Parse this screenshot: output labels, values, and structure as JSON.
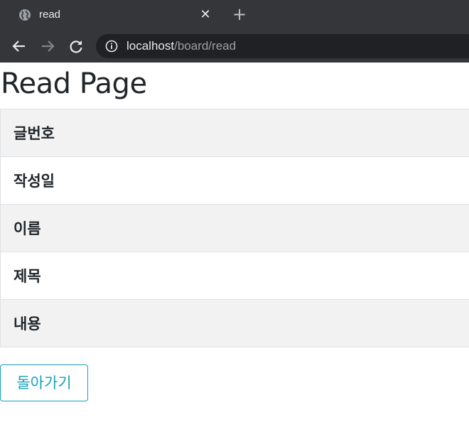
{
  "browser": {
    "tab": {
      "title": "read",
      "favicon": "globe-icon",
      "close_icon": "close-icon"
    },
    "new_tab_icon": "plus-icon",
    "nav": {
      "back": "arrow-left-icon",
      "forward": "arrow-right-icon",
      "reload": "reload-icon"
    },
    "address": {
      "host": "localhost",
      "path": "/board/read",
      "info_icon": "info-icon"
    }
  },
  "page": {
    "title": "Read Page",
    "fields": [
      {
        "label": "글번호"
      },
      {
        "label": "작성일"
      },
      {
        "label": "이름"
      },
      {
        "label": "제목"
      },
      {
        "label": "내용"
      }
    ],
    "back_button": "돌아가기"
  },
  "colors": {
    "chrome_bg": "#35363a",
    "omnibox_bg": "#202124",
    "striped_row": "#f2f2f2",
    "border": "#dee2e6",
    "button_accent": "#17a2b8",
    "text": "#212529"
  }
}
